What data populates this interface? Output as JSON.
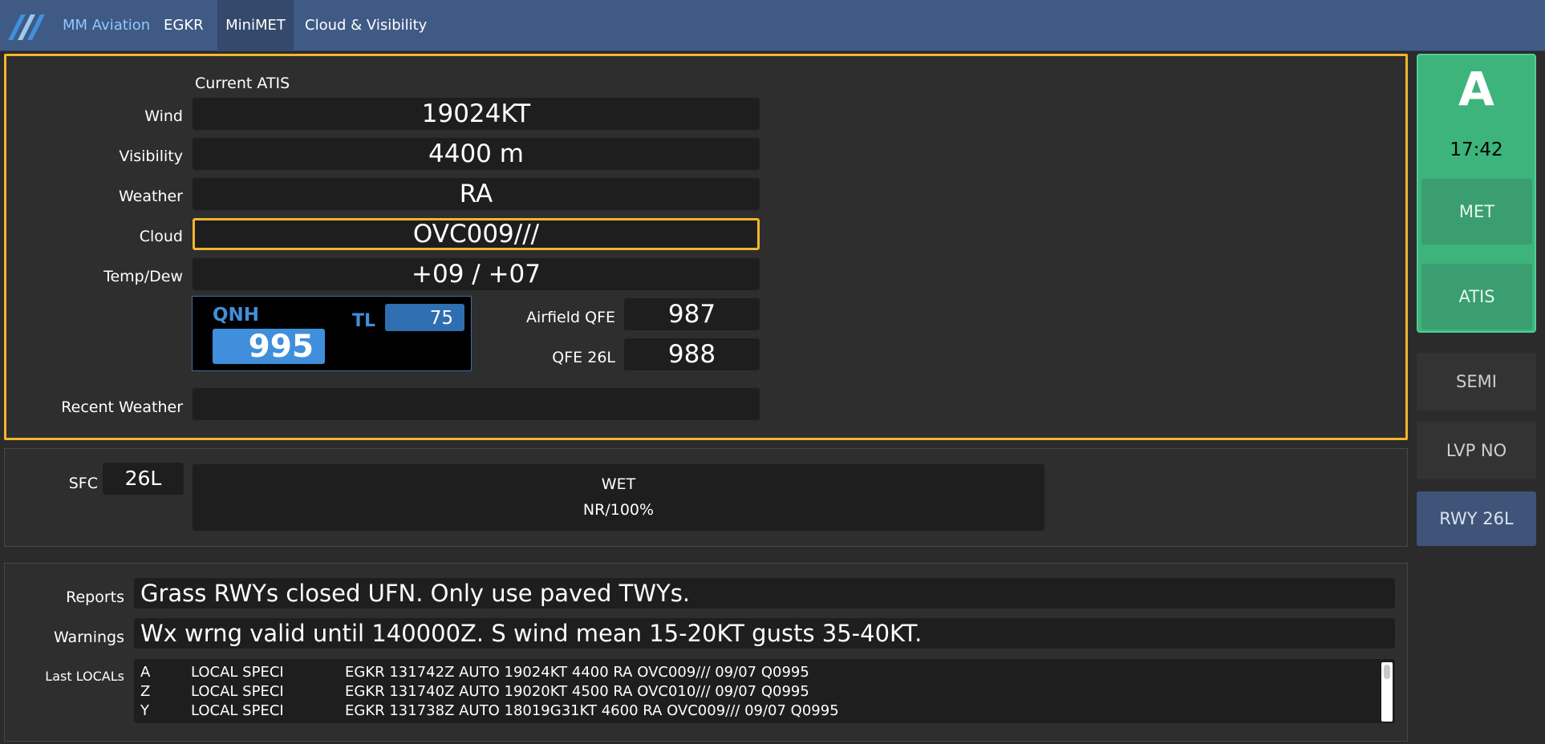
{
  "nav": {
    "brand": "MM Aviation",
    "airport": "EGKR",
    "active_tab": "MiniMET",
    "cloud_tab": "Cloud & Visibility"
  },
  "atis": {
    "heading": "Current ATIS",
    "wind_label": "Wind",
    "wind": "19024KT",
    "visibility_label": "Visibility",
    "visibility": "4400 m",
    "weather_label": "Weather",
    "weather": "RA",
    "cloud_label": "Cloud",
    "cloud": "OVC009///",
    "tempdew_label": "Temp/Dew",
    "tempdew": "+09 / +07",
    "qnh_label": "QNH",
    "qnh": "995",
    "tl_label": "TL",
    "tl": "75",
    "airfield_qfe_label": "Airfield QFE",
    "airfield_qfe": "987",
    "qfe_rwy_label": "QFE 26L",
    "qfe_rwy": "988",
    "recent_weather_label": "Recent Weather",
    "recent_weather": ""
  },
  "surface": {
    "label": "SFC",
    "runway": "26L",
    "condition": "WET",
    "braking": "NR/100%"
  },
  "reports": {
    "reports_label": "Reports",
    "reports": "Grass RWYs closed UFN. Only use paved TWYs.",
    "warnings_label": "Warnings",
    "warnings": "Wx wrng valid until 140000Z. S wind mean 15-20KT gusts 35-40KT.",
    "locals_label": "Last LOCALs",
    "locals": [
      {
        "id": "A",
        "type": "LOCAL SPECI",
        "text": "EGKR 131742Z AUTO 19024KT 4400 RA OVC009/// 09/07 Q0995"
      },
      {
        "id": "Z",
        "type": "LOCAL SPECI",
        "text": "EGKR 131740Z AUTO 19020KT 4500 RA OVC010/// 09/07 Q0995"
      },
      {
        "id": "Y",
        "type": "LOCAL SPECI",
        "text": "EGKR 131738Z AUTO 18019G31KT 4600 RA OVC009/// 09/07 Q0995"
      }
    ]
  },
  "sidebar": {
    "atis_letter": "A",
    "time": "17:42",
    "met_button": "MET",
    "atis_button": "ATIS",
    "semi_button": "SEMI",
    "lvp_button": "LVP NO",
    "rwy_button": "RWY 26L"
  },
  "colors": {
    "topbar": "#3f5a85",
    "selected_border": "#f2b52c",
    "qnh_blue": "#3f8fdc",
    "sidebar_green": "#3cb47c"
  },
  "icons": {
    "logo": "mm-aviation-stripes-logo"
  }
}
